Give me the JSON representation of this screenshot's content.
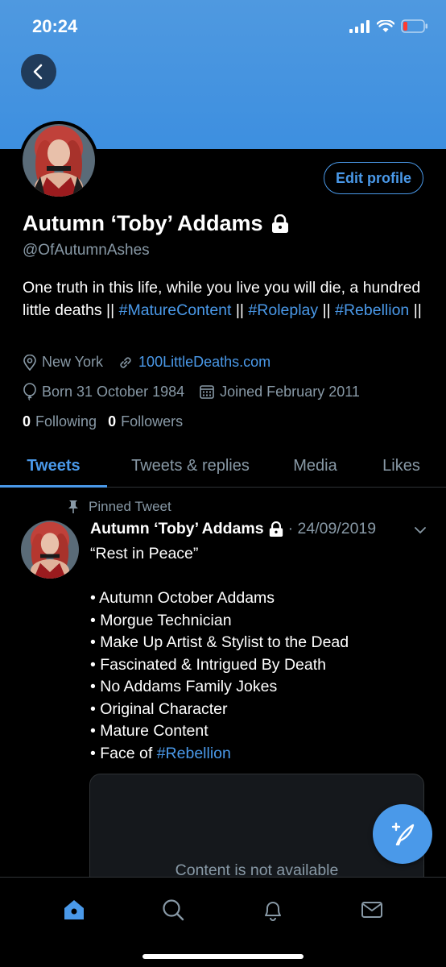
{
  "status": {
    "time": "20:24"
  },
  "profile": {
    "name": "Autumn ‘Toby’ Addams",
    "handle": "@OfAutumnAshes",
    "edit_label": "Edit profile",
    "bio_parts": [
      {
        "text": "One truth in this life, while you live you will die, a hundred little deaths || ",
        "link": false
      },
      {
        "text": "#MatureContent",
        "link": true
      },
      {
        "text": " || ",
        "link": false
      },
      {
        "text": "#Roleplay",
        "link": true
      },
      {
        "text": " || ",
        "link": false
      },
      {
        "text": "#Rebellion",
        "link": true
      },
      {
        "text": " ||",
        "link": false
      }
    ],
    "location": "New York",
    "website": "100LittleDeaths.com",
    "birth": "Born 31 October 1984",
    "joined": "Joined February 2011",
    "following_count": "0",
    "following_label": "Following",
    "followers_count": "0",
    "followers_label": "Followers"
  },
  "tabs": [
    "Tweets",
    "Tweets & replies",
    "Media",
    "Likes"
  ],
  "pinned_label": "Pinned Tweet",
  "tweet": {
    "name": "Autumn ‘Toby’ Addams",
    "date": "· 24/09/2019",
    "title": "“Rest in Peace”",
    "bullets": [
      "• Autumn October Addams",
      "• Morgue Technician",
      "• Make Up Artist & Stylist to the Dead",
      "• Fascinated & Intrigued By Death",
      "• No Addams Family Jokes",
      "• Original Character",
      "• Mature Content"
    ],
    "last_bullet_prefix": "• Face of ",
    "last_bullet_tag": "#Rebellion",
    "card_text": "Content is not available"
  },
  "colors": {
    "accent": "#4a99e9",
    "banner": "#3d8fe0",
    "muted": "#8899a6"
  },
  "nav_icons": [
    "home-icon",
    "search-icon",
    "notifications-icon",
    "messages-icon"
  ]
}
